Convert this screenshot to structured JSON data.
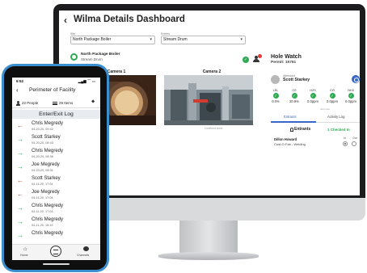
{
  "dashboard": {
    "title": "Wilma Details Dashboard",
    "back_icon": "chevron-left-icon",
    "selectors": [
      {
        "label": "Site",
        "value": "North Package Boiler"
      },
      {
        "label": "Entries",
        "value": "Stream Drum"
      }
    ],
    "location": {
      "name": "North Package Boiler",
      "sub": "Stream Drum",
      "icon": "location-circle-icon"
    },
    "cameras": [
      {
        "label": "Camera 1",
        "caption": "Live Feed"
      },
      {
        "label": "Camera 2",
        "caption": "Confined Area"
      }
    ],
    "hole_watch": {
      "title": "Hole Watch",
      "permit": "Permit: 15761",
      "attendant_label": "Attendant",
      "attendant_name": "Scott Starkey",
      "gases": [
        {
          "name": "LEL",
          "value": "0.0%"
        },
        {
          "name": "O2",
          "value": "20.9%"
        },
        {
          "name": "H2S",
          "value": "0.0ppm"
        },
        {
          "name": "CO",
          "value": "0.0ppm"
        },
        {
          "name": "NH3",
          "value": "0.0ppm"
        }
      ],
      "gas_note": "Just now",
      "tabs": [
        "Entrants",
        "Activity Log"
      ],
      "entrants_label": "Entrants",
      "checked_in": "1 Checked In",
      "entrant": {
        "name": "Dillon Howard",
        "company": "Cust-O-Fab - Welding",
        "in_label": "In",
        "out_label": "Out"
      }
    }
  },
  "phone": {
    "time": "9:52",
    "status_icons": "▂▄▆ ⌒ ▭",
    "title": "Perimeter of Facility",
    "people": "22 People",
    "items": "29 Items",
    "log_title": "Enter/Exit Log",
    "entries": [
      {
        "name": "Chris Megredy",
        "date": "04-20-20, 09:42",
        "dir": "out"
      },
      {
        "name": "Scott Starkey",
        "date": "04-20-20, 08:43",
        "dir": "in"
      },
      {
        "name": "Chris Megredy",
        "date": "04-20-20, 08:36",
        "dir": "in"
      },
      {
        "name": "Joe Megredy",
        "date": "04-20-20, 08:31",
        "dir": "in"
      },
      {
        "name": "Scott Starkey",
        "date": "04-11-20, 17:04",
        "dir": "out"
      },
      {
        "name": "Joe Megredy",
        "date": "04-11-20, 17:04",
        "dir": "out"
      },
      {
        "name": "Chris Megredy",
        "date": "04-11-20, 17:04",
        "dir": "in"
      },
      {
        "name": "Chris Megredy",
        "date": "04-11-20, 15:19",
        "dir": "in"
      },
      {
        "name": "Chris Megredy",
        "date": "",
        "dir": "in"
      }
    ],
    "nav": {
      "home": "Home",
      "channels": "Channels"
    }
  },
  "colors": {
    "accent_blue": "#3867c9",
    "status_green": "#2eaa52",
    "exit_red": "#d23b3b",
    "phone_case": "#3c8fce"
  }
}
